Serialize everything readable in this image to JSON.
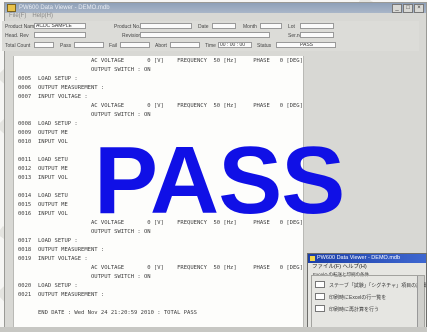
{
  "window": {
    "title": "PW600 Data Viewer - DEMO.mdb",
    "menu": [
      "File(F)",
      "Help(H)"
    ],
    "controls": [
      "_",
      "□",
      "×"
    ]
  },
  "header": {
    "product_name_label": "Product Name",
    "product_name_value": "ACDC SAMPLE",
    "product_no_label": "Product No.",
    "product_no_value": "",
    "date_label": "Date",
    "month_label": "Month",
    "lot_label": "Lot",
    "head_rev_label": "Head. Rev",
    "revision_label": "Revision",
    "serial_label": "Ser.no",
    "total_count_label": "Total Count",
    "total_count_value": "",
    "pass_label": "Pass",
    "pass_value": "",
    "fail_label": "Fail",
    "fail_value": "",
    "abort_label": "Abort",
    "abort_value": "",
    "time_label": "Time",
    "time_value": "00 : 00 : 00",
    "status_label": "Status",
    "status_value": "PASS"
  },
  "log": [
    {
      "num": "",
      "text": "                AC VOLTAGE       0 [V]    FREQUENCY  50 [Hz]     PHASE   0 [DEG]"
    },
    {
      "num": "",
      "text": "                OUTPUT SWITCH : ON"
    },
    {
      "num": "0005",
      "text": "LOAD SETUP :"
    },
    {
      "num": "0006",
      "text": "OUTPUT MEASUREMENT :"
    },
    {
      "num": "0007",
      "text": "INPUT VOLTAGE :"
    },
    {
      "num": "",
      "text": "                AC VOLTAGE       0 [V]    FREQUENCY  50 [Hz]     PHASE   0 [DEG]"
    },
    {
      "num": "",
      "text": "                OUTPUT SWITCH : ON"
    },
    {
      "num": "0008",
      "text": "LOAD SETUP :"
    },
    {
      "num": "0009",
      "text": "OUTPUT ME"
    },
    {
      "num": "0010",
      "text": "INPUT VOL"
    },
    {
      "num": "",
      "text": ""
    },
    {
      "num": "0011",
      "text": "LOAD SETU"
    },
    {
      "num": "0012",
      "text": "OUTPUT ME"
    },
    {
      "num": "0013",
      "text": "INPUT VOL"
    },
    {
      "num": "",
      "text": ""
    },
    {
      "num": "0014",
      "text": "LOAD SETU"
    },
    {
      "num": "0015",
      "text": "OUTPUT ME"
    },
    {
      "num": "0016",
      "text": "INPUT VOL"
    },
    {
      "num": "",
      "text": "                AC VOLTAGE       0 [V]    FREQUENCY  50 [Hz]     PHASE   0 [DEG]"
    },
    {
      "num": "",
      "text": "                OUTPUT SWITCH : ON"
    },
    {
      "num": "0017",
      "text": "LOAD SETUP :"
    },
    {
      "num": "0018",
      "text": "OUTPUT MEASUREMENT :"
    },
    {
      "num": "0019",
      "text": "INPUT VOLTAGE :"
    },
    {
      "num": "",
      "text": "                AC VOLTAGE       0 [V]    FREQUENCY  50 [Hz]     PHASE   0 [DEG]"
    },
    {
      "num": "",
      "text": "                OUTPUT SWITCH : ON"
    },
    {
      "num": "0020",
      "text": "LOAD SETUP :"
    },
    {
      "num": "0021",
      "text": "OUTPUT MEASUREMENT :"
    },
    {
      "num": "",
      "text": ""
    },
    {
      "num": "",
      "text": "END DATE : Wed Nov 24 21:20:59 2010 : TOTAL PASS"
    }
  ],
  "stamp": "PASS",
  "popup": {
    "title": "PW600 Data Viewer - DEMO.mdb",
    "menu": "ファイル(F)   ヘルプ(H)",
    "heading": "Excelへの転送と印刷の条件",
    "options": [
      "ステーブ「試験」「シグネチャ」項目の詳細",
      "印刷時にExcelの行一覧を",
      "印刷時に再計算を行う"
    ]
  }
}
